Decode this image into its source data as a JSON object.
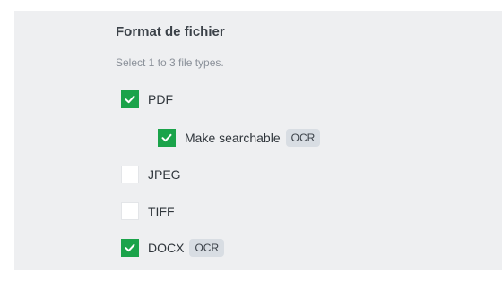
{
  "form": {
    "title": "Format de fichier",
    "helper": "Select 1 to 3 file types.",
    "check_icon": "check-icon",
    "colors": {
      "checked_fill": "#1aa34a",
      "panel_bg": "#eeeff1",
      "tag_bg": "#d8dde3"
    },
    "options": [
      {
        "label": "PDF",
        "checked": true
      },
      {
        "label": "Make searchable",
        "checked": true,
        "tag": "OCR"
      },
      {
        "label": "JPEG",
        "checked": false
      },
      {
        "label": "TIFF",
        "checked": false
      },
      {
        "label": "DOCX",
        "checked": true,
        "tag": "OCR"
      }
    ]
  }
}
